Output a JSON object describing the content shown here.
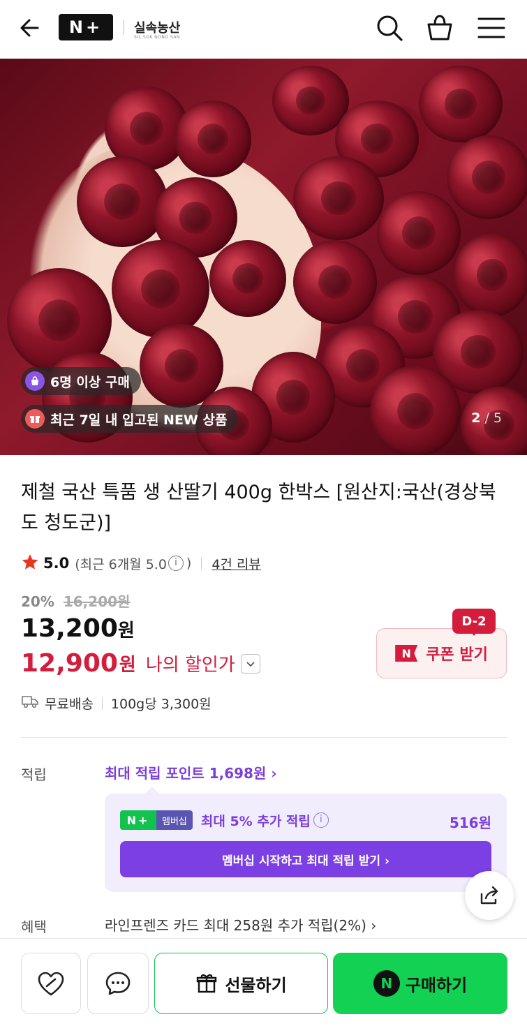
{
  "header": {
    "brand_logo": "N+",
    "store_name": "실속농산",
    "store_subtitle": "SIL SOK NONG SAN"
  },
  "gallery": {
    "badge_buyers": "6명 이상 구매",
    "badge_new": "최근 7일 내 입고된 NEW 상품",
    "page_current": "2",
    "page_total": "5"
  },
  "product": {
    "title": "제철 국산 특품 생 산딸기 400g 한박스 [원산지:국산(경상북도 청도군)]",
    "rating": "5.0",
    "rating_recent": "(최근 6개월 5.0",
    "rating_close": ")",
    "reviews": "4건 리뷰"
  },
  "price": {
    "discount_pct": "20%",
    "original": "16,200원",
    "sale": "13,200",
    "won": "원",
    "my_price": "12,900",
    "my_price_label": "나의 할인가"
  },
  "coupon": {
    "dday": "D-2",
    "label": "쿠폰 받기"
  },
  "shipping": {
    "free": "무료배송",
    "unit_price": "100g당 3,300원"
  },
  "points": {
    "label": "적립",
    "max_link": "최대 적립 포인트 1,698원 ›",
    "membership_tag": "멤버십",
    "membership_text": "최대 5% 추가 적립",
    "membership_amount": "516원",
    "membership_button": "멤버십 시작하고 최대 적립 받기 ›"
  },
  "benefit": {
    "label": "혜택",
    "text": "라인프렌즈 카드 최대 258원 추가 적립(2%) ›"
  },
  "bottom_bar": {
    "gift": "선물하기",
    "buy": "구매하기"
  },
  "colors": {
    "accent_red": "#d41c3c",
    "accent_purple": "#7a3fd9",
    "naver_green": "#12d153"
  }
}
